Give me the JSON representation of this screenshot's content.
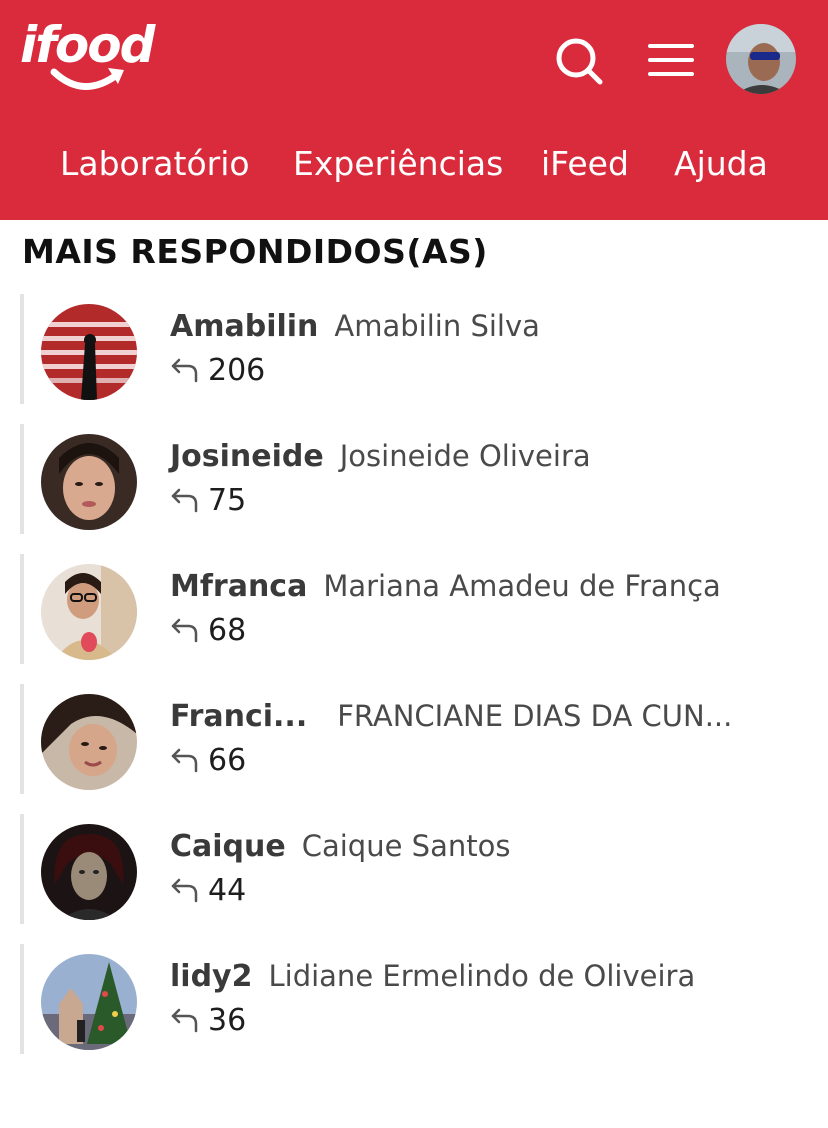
{
  "header": {
    "logo_text": "ifood",
    "background_color": "#d92b3c",
    "icons": {
      "search": "search-icon",
      "menu": "hamburger-menu-icon",
      "profile": "user-avatar"
    }
  },
  "nav": {
    "items": [
      {
        "label": "Laboratório"
      },
      {
        "label": "Experiências"
      },
      {
        "label": "iFeed"
      },
      {
        "label": "Ajuda"
      }
    ]
  },
  "section": {
    "title": "MAIS RESPONDIDOS(AS)"
  },
  "users": [
    {
      "nick": "Amabilin",
      "full_name": "Amabilin Silva",
      "replies": "206"
    },
    {
      "nick": "Josineide",
      "full_name": "Josineide Oliveira",
      "replies": "75"
    },
    {
      "nick": "Mfranca",
      "full_name": "Mariana Amadeu de França",
      "replies": "68"
    },
    {
      "nick": "Franci...",
      "full_name": "FRANCIANE DIAS DA CUN...",
      "replies": "66"
    },
    {
      "nick": "Caique",
      "full_name": "Caique Santos",
      "replies": "44"
    },
    {
      "nick": "lidy2",
      "full_name": "Lidiane Ermelindo de Oliveira",
      "replies": "36"
    }
  ]
}
